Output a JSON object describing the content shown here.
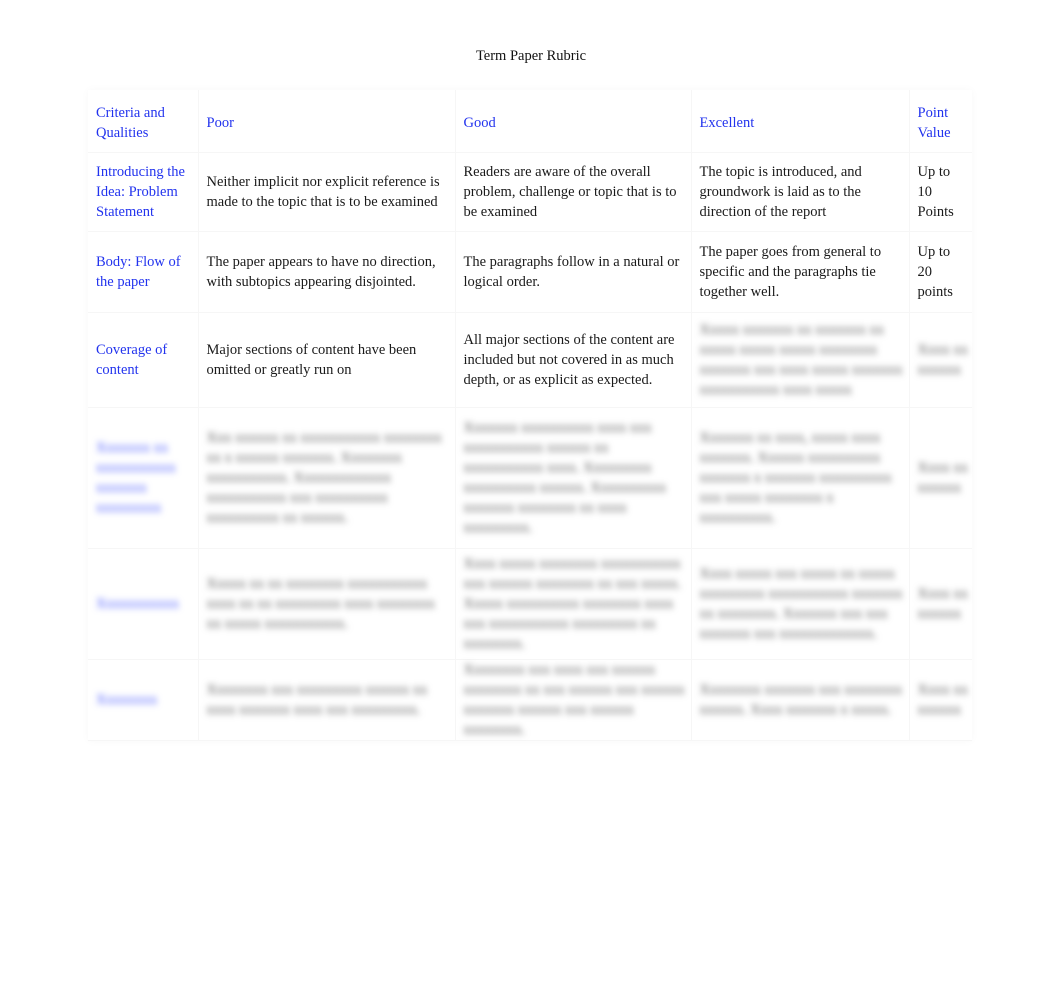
{
  "document": {
    "title": "Term Paper Rubric"
  },
  "table": {
    "headers": {
      "criteria": "Criteria and Qualities",
      "poor": "Poor",
      "good": "Good",
      "excellent": "Excellent",
      "points": "Point Value"
    },
    "rows": [
      {
        "criteria": "Introducing the Idea: Problem Statement",
        "poor": "Neither implicit nor explicit reference is made to the topic that is to be examined",
        "good": "Readers are aware of the overall problem, challenge or topic  that is to be examined",
        "excellent": "The topic is introduced, and groundwork is laid as to the direction of the report",
        "points": "Up to 10 Points"
      },
      {
        "criteria": "Body: Flow of the paper",
        "poor": "The paper appears to have no direction, with subtopics appearing disjointed.",
        "good": "The paragraphs follow in a natural or logical order.",
        "excellent": "The paper goes from general to specific and the paragraphs tie together well.",
        "points": "Up to 20 points"
      },
      {
        "criteria": "Coverage of content",
        "poor": "Major sections of content have been omitted or greatly run on",
        "good": "All major sections of the content are included but not covered in as much depth, or as explicit as expected.",
        "excellent": "Xxxxx xxxxxxx xx xxxxxxx xx xxxxx xxxxx xxxxx xxxxxxxx xxxxxxx xxx xxxx xxxxx xxxxxxx xxxxxxxxxxx xxxx xxxxx",
        "points": "Xxxx xx xxxxxx"
      },
      {
        "criteria": "Xxxxxxx xx xxxxxxxxxxx xxxxxxx xxxxxxxxx",
        "poor": "Xxx xxxxxx xx xxxxxxxxxxx xxxxxxxx xx x xxxxxx xxxxxxx. Xxxxxxxx xxxxxxxxxxx. Xxxxxxxxxxxxx xxxxxxxxxxx xxx xxxxxxxxxx xxxxxxxxxx xx xxxxxx.",
        "good": "Xxxxxxx xxxxxxxxxx xxxx xxx xxxxxxxxxxx xxxxxx xx xxxxxxxxxxx xxxx. Xxxxxxxxx xxxxxxxxxx xxxxxx. Xxxxxxxxxx xxxxxxx xxxxxxxx xx xxxx xxxxxxxxx.",
        "excellent": "Xxxxxxx xx xxxx, xxxxx xxxx xxxxxxx. Xxxxxx xxxxxxxxxx xxxxxxx x xxxxxxx xxxxxxxxxx xxx xxxxx xxxxxxxx x xxxxxxxxxx.",
        "points": "Xxxx xx xxxxxx"
      },
      {
        "criteria": "Xxxxxxxxxxx",
        "poor": "Xxxxx xx xx xxxxxxxx xxxxxxxxxxx xxxx xx xx xxxxxxxxx xxxx xxxxxxxx xx xxxxx xxxxxxxxxxx.",
        "good": "Xxxx xxxxx xxxxxxxx xxxxxxxxxxx xxx xxxxxx xxxxxxxx xx xxx xxxxx. Xxxxx xxxxxxxxxx xxxxxxxx xxxx xxx xxxxxxxxxxx xxxxxxxxx xx xxxxxxxx.",
        "excellent": "Xxxx xxxxx xxx xxxxx xx xxxxx xxxxxxxxx xxxxxxxxxxx xxxxxxx xx xxxxxxxx. Xxxxxxx xxx xxx xxxxxxx xxx xxxxxxxxxxxxx.",
        "points": "Xxxx xx xxxxxx"
      },
      {
        "criteria": "Xxxxxxxx",
        "poor": "Xxxxxxxx xxx xxxxxxxxx xxxxxx xx xxxx xxxxxxx xxxx xxx xxxxxxxxx.",
        "good": "Xxxxxxxx xxx xxxx xxx xxxxxx xxxxxxxx xx xxx xxxxxx xxx xxxxxx xxxxxxx xxxxxx xxx xxxxxx xxxxxxxx.",
        "excellent": "Xxxxxxxx xxxxxxx xxx xxxxxxxx xxxxxx. Xxxx xxxxxxx x xxxxx.",
        "points": "Xxxx xx xxxxxx"
      }
    ]
  },
  "colors": {
    "header_text": "#2233ee",
    "body_text": "#1a1a1a",
    "background": "#ffffff"
  }
}
